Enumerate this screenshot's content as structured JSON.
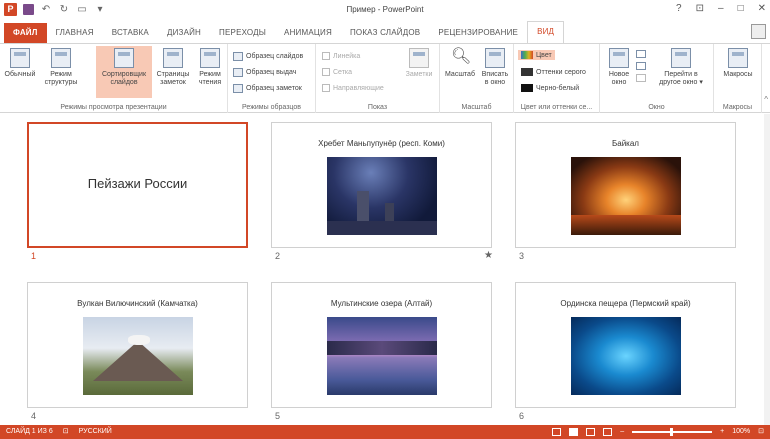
{
  "window": {
    "title": "Пример - PowerPoint",
    "help": "?",
    "controls": [
      "–",
      "□",
      "✕"
    ]
  },
  "tabs": [
    {
      "label": "ФАЙЛ"
    },
    {
      "label": "ГЛАВНАЯ"
    },
    {
      "label": "ВСТАВКА"
    },
    {
      "label": "ДИЗАЙН"
    },
    {
      "label": "ПЕРЕХОДЫ"
    },
    {
      "label": "АНИМАЦИЯ"
    },
    {
      "label": "ПОКАЗ СЛАЙДОВ"
    },
    {
      "label": "РЕЦЕНЗИРОВАНИЕ"
    },
    {
      "label": "ВИД"
    }
  ],
  "ribbon": {
    "views": {
      "label": "Режимы просмотра презентации",
      "buttons": [
        {
          "line1": "Обычный",
          "line2": ""
        },
        {
          "line1": "Режим",
          "line2": "структуры"
        },
        {
          "line1": "Сортировщик",
          "line2": "слайдов"
        },
        {
          "line1": "Страницы",
          "line2": "заметок"
        },
        {
          "line1": "Режим",
          "line2": "чтения"
        }
      ]
    },
    "masters": {
      "label": "Режимы образцов",
      "items": [
        "Образец слайдов",
        "Образец выдач",
        "Образец заметок"
      ]
    },
    "show": {
      "label": "Показ",
      "items": [
        "Линейка",
        "Сетка",
        "Направляющие"
      ],
      "notes": "Заметки"
    },
    "zoom": {
      "label": "Масштаб",
      "zoom_btn": "Масштаб",
      "fit_line1": "Вписать",
      "fit_line2": "в окно"
    },
    "color": {
      "label": "Цвет или оттенки се...",
      "items": [
        "Цвет",
        "Оттенки серого",
        "Черно-белый"
      ]
    },
    "window": {
      "label": "Окно",
      "new_line1": "Новое",
      "new_line2": "окно",
      "switch_line1": "Перейти в",
      "switch_line2": "другое окно ▾"
    },
    "macros": {
      "label": "Макросы",
      "btn": "Макросы"
    }
  },
  "slides": [
    {
      "num": "1",
      "title": "Пейзажи России",
      "selected": true
    },
    {
      "num": "2",
      "title": "Хребет Маньпупунёр (респ. Коми)",
      "star": "★"
    },
    {
      "num": "3",
      "title": "Байкал"
    },
    {
      "num": "4",
      "title": "Вулкан Вилючинский (Камчатка)"
    },
    {
      "num": "5",
      "title": "Мультинские озера (Алтай)"
    },
    {
      "num": "6",
      "title": "Ординска пещера (Пермский край)"
    }
  ],
  "status": {
    "slide": "СЛАЙД 1 ИЗ 6",
    "language": "РУССКИЙ",
    "zoom": "100%"
  },
  "colors": {
    "accent": "#d24726",
    "selected_button": "#f8c9b5"
  }
}
